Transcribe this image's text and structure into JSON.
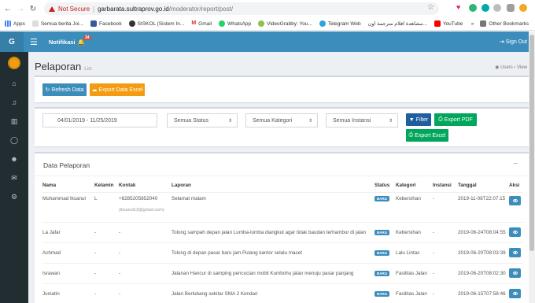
{
  "browser": {
    "not_secure": "Not Secure",
    "url_host": "garbarata.sultraprov.go.id",
    "url_path": "/moderator/report/post/",
    "bookmarks": [
      "Apps",
      "Semua berita Joi...",
      "Facebook",
      "SISKOL (Sistem In...",
      "Gmail",
      "WhatsApp",
      "VideoGrabby: You...",
      "Telegram Web",
      "مشاهدة افلام مترجمة اون...",
      "YouTube"
    ],
    "other_bookmarks": "Other Bookmarks",
    "more": "»"
  },
  "header": {
    "brand": "G",
    "notifikasi": "Notifikasi",
    "notif_count": "34",
    "signout": "Sign Out"
  },
  "page": {
    "title": "Pelaporan",
    "subtitle": "List",
    "breadcrumb_home": "Users",
    "breadcrumb_current": "View"
  },
  "actions": {
    "refresh": "Refresh Data",
    "export_excel": "Export Data Excel"
  },
  "filters": {
    "date_range": "04/01/2019 - 11/25/2019",
    "status": "Semua Status",
    "kategori": "Semua Kategori",
    "instansi": "Semua Instansi",
    "filter_btn": "Filter",
    "export_pdf": "Export PDF",
    "export_excel": "Export Excel"
  },
  "table": {
    "title": "Data Pelaporan",
    "collapse": "−",
    "columns": [
      "Nama",
      "Kelamin",
      "Kontak",
      "Laporan",
      "Status",
      "Kategori",
      "Instansi",
      "Tanggal",
      "Aksi"
    ],
    "rows": [
      {
        "nama": "Muhammad Iksanul",
        "kelamin": "L",
        "kontak": "+6285205852040",
        "email": "(iksanul13@gmail.com)",
        "laporan": "Selamat malam",
        "status": "BARU",
        "kategori": "Kebersihan",
        "instansi": "-",
        "tanggal": "2019-11-08T22:07:15"
      },
      {
        "nama": "La Jafar",
        "kelamin": "-",
        "kontak": "-",
        "email": "",
        "laporan": "Tolong sampah depan jalan Lumba-lumba diangkut agar tidak baudan terhambur di jalan",
        "status": "BARU",
        "kategori": "Kebersihan",
        "instansi": "-",
        "tanggal": "2019-06-24T08:04:55"
      },
      {
        "nama": "Achmad",
        "kelamin": "-",
        "kontak": "-",
        "email": "",
        "laporan": "Tolong di depan pasar baru jam Pulang kantor selalu macet",
        "status": "BARU",
        "kategori": "Lalu Lintas",
        "instansi": "-",
        "tanggal": "2019-06-20T08:03:39"
      },
      {
        "nama": "Israwan",
        "kelamin": "-",
        "kontak": "-",
        "email": "",
        "laporan": "Jalanan Hancur di samping pencucian mobil Kumbohu jalan menuju pasar panjang",
        "status": "BARU",
        "kategori": "Fasilitas Jalan",
        "instansi": "-",
        "tanggal": "2019-06-20T08:02:30"
      },
      {
        "nama": "Juniatin",
        "kelamin": "-",
        "kontak": "-",
        "email": "",
        "laporan": "Jalan Berlubang sekitar SMA 2 Kendari",
        "status": "BARU",
        "kategori": "Fasilitas Jalan",
        "instansi": "-",
        "tanggal": "2019-06-15T07:58:46"
      }
    ]
  }
}
